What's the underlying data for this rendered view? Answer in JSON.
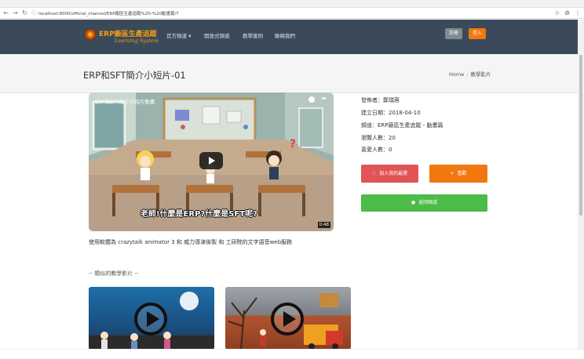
{
  "browser": {
    "back_icon": "←",
    "forward_icon": "→",
    "reload_icon": "↻",
    "url_prefix_icon": "ⓘ",
    "url": "localhost:8000/official_channel/ERP廠區生產追蹤%20-%20動畫篇/7",
    "right_icons": [
      "☆",
      "⊘",
      "⋮"
    ]
  },
  "nav": {
    "brand_title": "ERP廠區生產追蹤",
    "brand_subtitle": "Learning System",
    "items": [
      "官方頻道 ▾",
      "開放式頻道",
      "教學案例",
      "聯絡我們"
    ],
    "register": "註冊",
    "login": "登入"
  },
  "page": {
    "title": "ERP和SFT簡介小短片-01",
    "breadcrumb_home": "Home",
    "breadcrumb_current": "教學影片"
  },
  "video": {
    "title": "ERP和SFT簡介小短片動畫",
    "caption": "老師!什麼是ERP?什麼是SFT呢?",
    "duration": "0:48",
    "question_mark": "?"
  },
  "description": "使用軟體為 crazytalk animator 3 和 威力導演後製 和 工研院的文字語音web服務",
  "related_heading": "-- 類似的教學影片 --",
  "info": {
    "publisher": "發佈者：鄭瑞蓉",
    "created": "建立日期：2018-04-10",
    "channel": "頻道：ERP廠區生產追蹤 - 動畫篇",
    "views": "瀏覽人數：20",
    "likes": "喜愛人數：0"
  },
  "buttons": {
    "favorite": "加入我的最愛",
    "favorite_icon": "♡",
    "like": "喜歡",
    "like_icon": "+",
    "back": "返回頻道",
    "back_icon": "●"
  },
  "colors": {
    "navbar": "#3a4a5a",
    "brand": "#f39c12",
    "favorite": "#e05455",
    "like": "#f0780f",
    "back": "#4cbb47"
  }
}
